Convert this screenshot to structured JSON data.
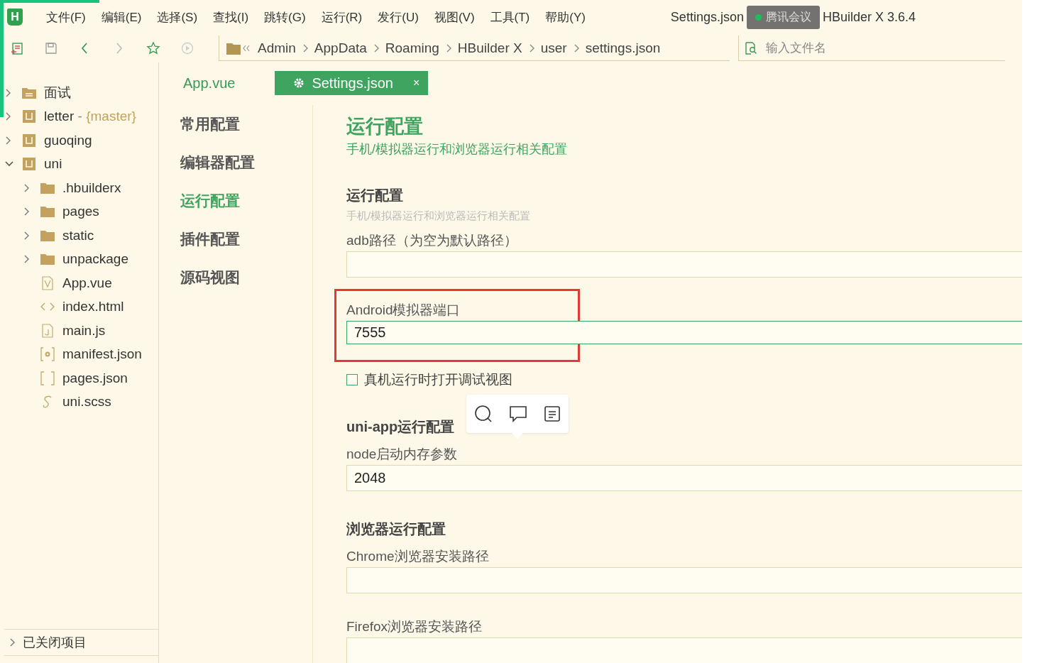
{
  "app": {
    "logo": "H"
  },
  "menu": [
    {
      "label": "文件(F)"
    },
    {
      "label": "编辑(E)"
    },
    {
      "label": "选择(S)"
    },
    {
      "label": "查找(I)"
    },
    {
      "label": "跳转(G)"
    },
    {
      "label": "运行(R)"
    },
    {
      "label": "发行(U)"
    },
    {
      "label": "视图(V)"
    },
    {
      "label": "工具(T)"
    },
    {
      "label": "帮助(Y)"
    }
  ],
  "window": {
    "title_start": "Settings.json",
    "title_end": "HBuilder X 3.6.4",
    "meeting_overlay": "腾讯会议"
  },
  "breadcrumb": [
    "Admin",
    "AppData",
    "Roaming",
    "HBuilder X",
    "user",
    "settings.json"
  ],
  "file_search": {
    "placeholder": "输入文件名"
  },
  "tree": [
    {
      "label": "面试",
      "kind": "folder-project",
      "expanded": false
    },
    {
      "label": "letter",
      "separator": "-",
      "branch": "{master}",
      "kind": "project",
      "expanded": false
    },
    {
      "label": "guoqing",
      "kind": "project",
      "expanded": false
    },
    {
      "label": "uni",
      "kind": "project",
      "expanded": true,
      "children": [
        {
          "label": ".hbuilderx",
          "kind": "folder",
          "expanded": false
        },
        {
          "label": "pages",
          "kind": "folder",
          "expanded": false
        },
        {
          "label": "static",
          "kind": "folder",
          "expanded": false
        },
        {
          "label": "unpackage",
          "kind": "folder",
          "expanded": false
        },
        {
          "label": "App.vue",
          "kind": "vue"
        },
        {
          "label": "index.html",
          "kind": "html"
        },
        {
          "label": "main.js",
          "kind": "js"
        },
        {
          "label": "manifest.json",
          "kind": "manifest"
        },
        {
          "label": "pages.json",
          "kind": "json"
        },
        {
          "label": "uni.scss",
          "kind": "scss"
        }
      ]
    }
  ],
  "closed_projects": {
    "label": "已关闭项目",
    "expanded": false
  },
  "tabs": [
    {
      "label": "App.vue",
      "selected": false
    },
    {
      "label": "Settings.json",
      "selected": true,
      "close": "×"
    }
  ],
  "settings_nav": [
    {
      "label": "常用配置",
      "selected": false
    },
    {
      "label": "编辑器配置",
      "selected": false
    },
    {
      "label": "运行配置",
      "selected": true
    },
    {
      "label": "插件配置",
      "selected": false
    },
    {
      "label": "源码视图",
      "selected": false
    }
  ],
  "panel": {
    "title": "运行配置",
    "subtitle": "手机/模拟器运行和浏览器运行相关配置",
    "sections": [
      {
        "heading": "运行配置",
        "description": "手机/模拟器运行和浏览器运行相关配置",
        "fields": [
          {
            "kind": "text",
            "label": "adb路径（为空为默认路径）",
            "focused": false,
            "annotated": false
          },
          {
            "kind": "text",
            "label": "Android模拟器端口",
            "value": "7555",
            "focused": true,
            "annotated": true
          },
          {
            "kind": "checkbox",
            "label": "真机运行时打开调试视图",
            "checked": false
          }
        ]
      },
      {
        "heading": "uni-app运行配置",
        "fields": [
          {
            "kind": "text",
            "label": "node启动内存参数",
            "value": "2048",
            "focused": false,
            "annotated": false
          }
        ]
      },
      {
        "heading": "浏览器运行配置",
        "fields": [
          {
            "kind": "text",
            "label": "Chrome浏览器安装路径",
            "focused": false,
            "annotated": false
          },
          {
            "kind": "text",
            "label": "Firefox浏览器安装路径",
            "focused": false,
            "annotated": false
          }
        ]
      }
    ]
  }
}
